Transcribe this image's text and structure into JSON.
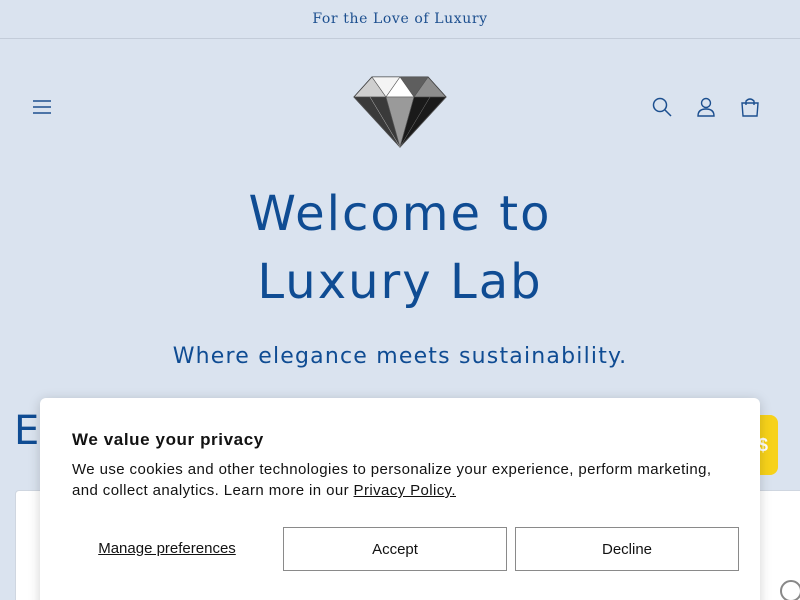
{
  "announcement": {
    "text": "For the Love of Luxury"
  },
  "header": {
    "logo_alt": "Luxury Lab diamond logo",
    "icons": {
      "menu": "hamburger-menu-icon",
      "search": "search-icon",
      "account": "user-icon",
      "cart": "shopping-bag-icon"
    }
  },
  "hero": {
    "title_line1": "Welcome to",
    "title_line2": "Luxury Lab",
    "subtitle": "Where elegance meets sustainability."
  },
  "section": {
    "heading_peek": "E",
    "badge_peek": "$"
  },
  "cookie": {
    "title": "We value your privacy",
    "body": "We use cookies and other technologies to personalize your experience, perform marketing, and collect analytics. Learn more in our ",
    "policy_link": "Privacy Policy.",
    "manage_label": "Manage preferences",
    "accept_label": "Accept",
    "decline_label": "Decline"
  },
  "colors": {
    "background": "#dae3ef",
    "brand_blue": "#0f4c93",
    "badge_yellow": "#f7d21a"
  }
}
